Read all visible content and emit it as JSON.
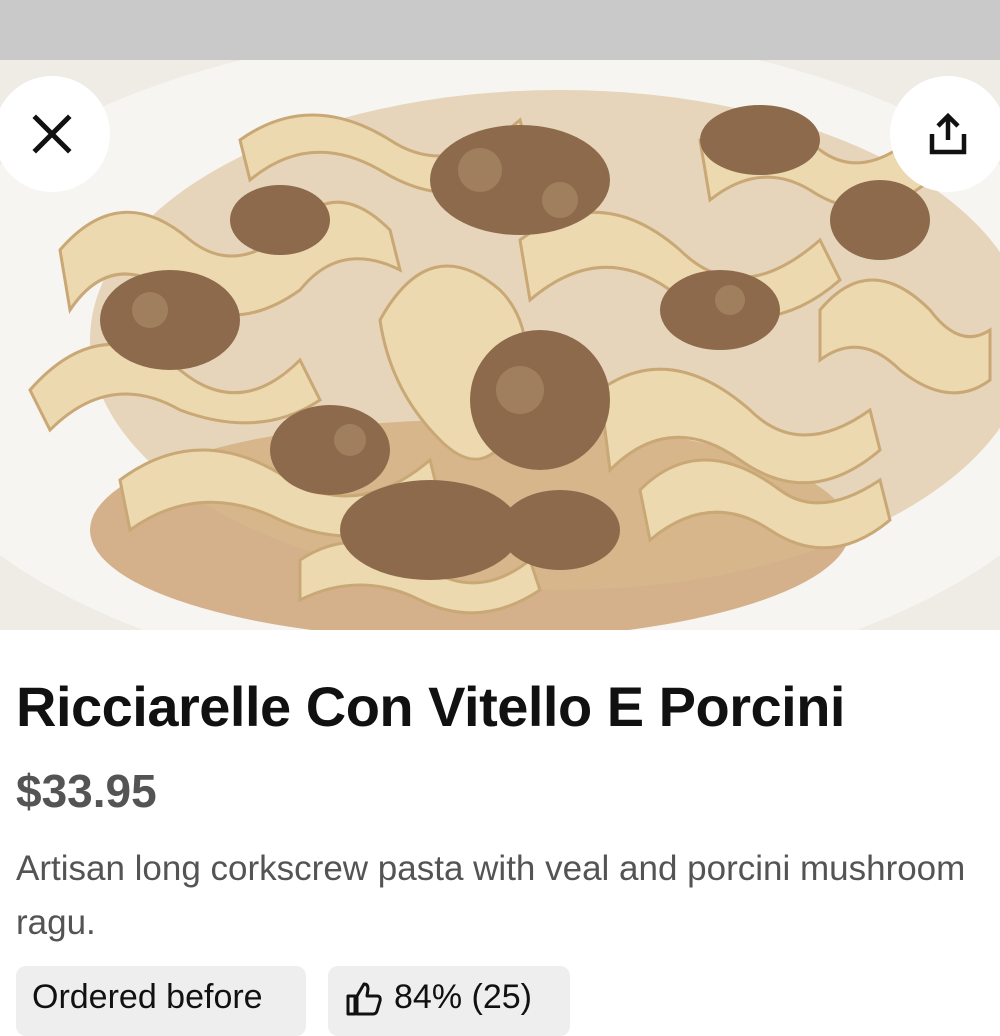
{
  "header": {
    "close_icon": "close-icon",
    "share_icon": "share-icon"
  },
  "item": {
    "title": "Ricciarelle Con Vitello E Porcini",
    "price": "$33.95",
    "description": "Artisan long corkscrew pasta with veal and porcini mushroom ragu.",
    "image_alt": "Ricciarelle pasta with veal and porcini ragu"
  },
  "chips": {
    "ordered_before": "Ordered before",
    "rating": "84% (25)",
    "rating_icon": "thumbs-up-icon"
  },
  "colors": {
    "title": "#111111",
    "secondary_text": "#545454",
    "chip_bg": "#eeeeee",
    "top_strip": "#c9c9c9"
  }
}
